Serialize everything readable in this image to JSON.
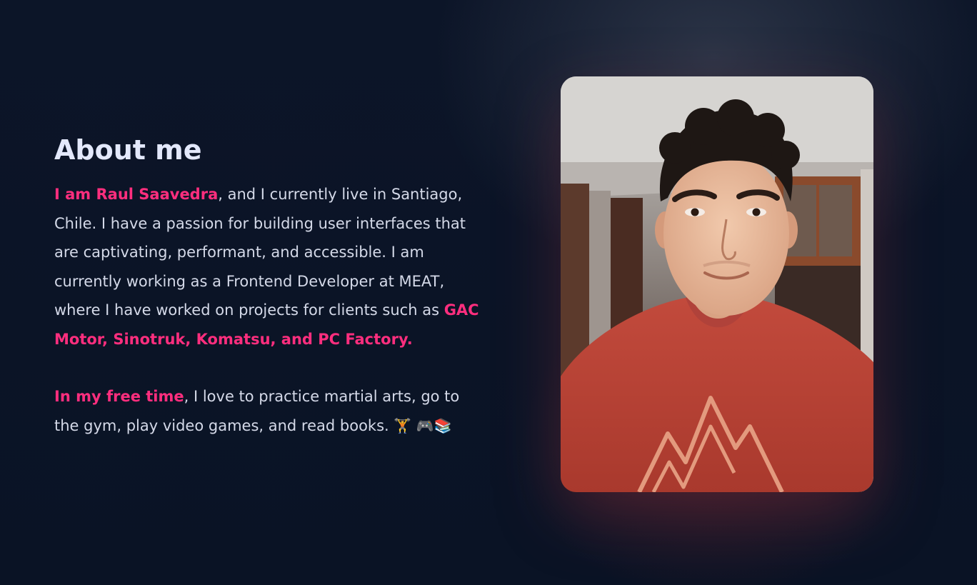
{
  "about": {
    "heading": "About me",
    "para1": {
      "highlight_name": "I am Raul Saavedra",
      "text1": ", and I currently live in Santiago, Chile. I have a passion for building user interfaces that are captivating, performant, and accessible. I am currently working as a Frontend Developer at MEAT, where I have worked on projects for clients such as ",
      "highlight_clients": "GAC Motor, Sinotruk, Komatsu, and PC Factory."
    },
    "para2": {
      "highlight_free": "In my free time",
      "text": ", I love to practice martial arts, go to the gym, play video games, and read books. ",
      "emojis": "🏋️ 🎮📚"
    }
  },
  "photo": {
    "icon": "portrait-photo"
  },
  "colors": {
    "background": "#0b1426",
    "heading": "#e3e8fb",
    "body_text": "#d4d9e8",
    "accent": "#ff2e7e"
  }
}
